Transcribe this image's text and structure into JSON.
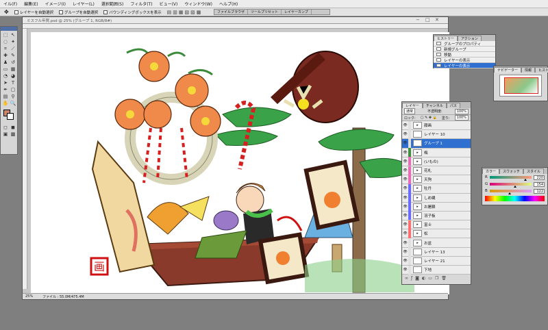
{
  "menubar": {
    "items": [
      "イル(F)",
      "編集(E)",
      "イメージ(I)",
      "レイヤー(L)",
      "選択範囲(S)",
      "フィルタ(T)",
      "ビュー(V)",
      "ウィンドウ(W)",
      "ヘルプ(H)"
    ]
  },
  "options": {
    "auto_select_layer": "レイヤーを自動選択",
    "auto_select_group": "グループを自動選択",
    "show_bounding_box": "バウンディングボックスを表示"
  },
  "workspace_tabs": [
    "ファイルブラウザ",
    "ツールプリセット",
    "レイヤーカンプ"
  ],
  "document": {
    "title": "ミスフル年賀.psd @ 25% (グループ 1, RGB/8#)",
    "zoom": "25%",
    "file_info": "ファイル : 55.0M/475.4M"
  },
  "history_panel": {
    "tabs": [
      "ヒストリー",
      "アクション"
    ],
    "items": [
      {
        "label": "グループのプロパティ",
        "selected": false
      },
      {
        "label": "新規グループ",
        "selected": false
      },
      {
        "label": "移動",
        "selected": false
      },
      {
        "label": "レイヤーの表示",
        "selected": false
      },
      {
        "label": "レイヤーの表示",
        "selected": false
      },
      {
        "label": "レイヤーの表示",
        "selected": true
      }
    ]
  },
  "navigator_panel": {
    "tabs": [
      "ナビゲーター",
      "情報",
      "ヒストグラム"
    ]
  },
  "layers_panel": {
    "tabs": [
      "レイヤー",
      "チャンネル",
      "パス"
    ],
    "blend_mode": "通常",
    "opacity_label": "不透明度:",
    "opacity_value": "100%",
    "lock_label": "ロック:",
    "fill_label": "塗り:",
    "fill_value": "100%",
    "layers": [
      {
        "name": "顔画",
        "type": "group",
        "color": "#e0e0e0",
        "selected": false
      },
      {
        "name": "レイヤー 10",
        "type": "layer",
        "color": "#e0e0e0",
        "selected": false
      },
      {
        "name": "グループ 1",
        "type": "group",
        "color": "#e0e0e0",
        "selected": true
      },
      {
        "name": "梅",
        "type": "group",
        "color": "#3f8f3f",
        "selected": false
      },
      {
        "name": "(いもの)",
        "type": "group",
        "color": "#e86db4",
        "selected": false
      },
      {
        "name": "花札",
        "type": "group",
        "color": "#e86db4",
        "selected": false
      },
      {
        "name": "天狗",
        "type": "group",
        "color": "#e86db4",
        "selected": false
      },
      {
        "name": "牡丹",
        "type": "group",
        "color": "#6b6bff",
        "selected": false
      },
      {
        "name": "しめ縄",
        "type": "group",
        "color": "#6b6bff",
        "selected": false
      },
      {
        "name": "お屠蘇",
        "type": "group",
        "color": "#6b6bff",
        "selected": false
      },
      {
        "name": "羽子板",
        "type": "group",
        "color": "#6b6bff",
        "selected": false
      },
      {
        "name": "富士",
        "type": "group",
        "color": "#ff7070",
        "selected": false
      },
      {
        "name": "松",
        "type": "group",
        "color": "#ff7070",
        "selected": false
      },
      {
        "name": "お盆",
        "type": "group",
        "color": "#e0e0e0",
        "selected": false
      },
      {
        "name": "レイヤー 13",
        "type": "layer",
        "color": "#e0e0e0",
        "selected": false
      },
      {
        "name": "レイヤー 21",
        "type": "layer",
        "color": "#e0e0e0",
        "selected": false
      },
      {
        "name": "下地",
        "type": "layer",
        "color": "#e0e0e0",
        "selected": false
      }
    ]
  },
  "color_panel": {
    "tabs": [
      "カラー",
      "スウォッチ",
      "スタイル"
    ],
    "channels": [
      {
        "label": "R",
        "value": "220",
        "fraction": 0.86
      },
      {
        "label": "G",
        "value": "154",
        "fraction": 0.6
      },
      {
        "label": "B",
        "value": "122",
        "fraction": 0.48
      }
    ]
  }
}
